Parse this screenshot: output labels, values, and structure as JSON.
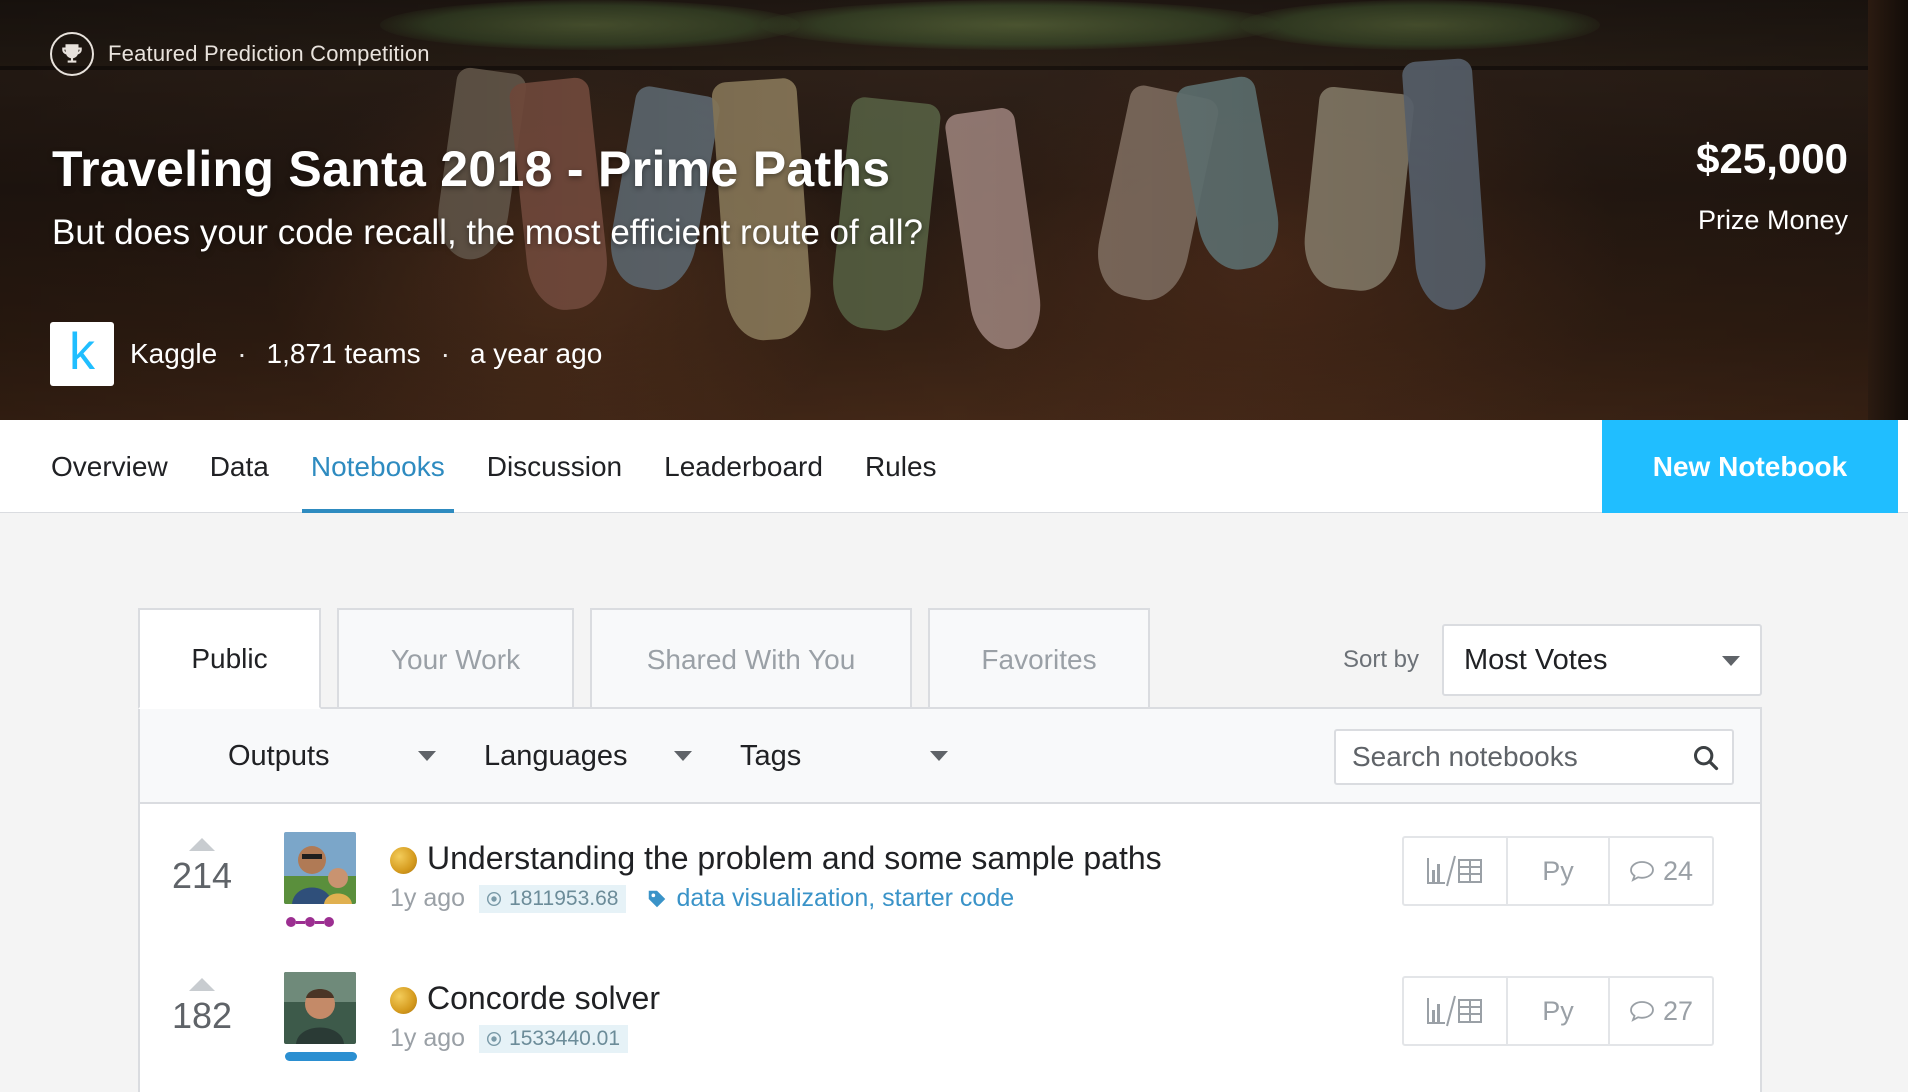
{
  "hero": {
    "badge": "Featured Prediction Competition",
    "title": "Traveling Santa 2018 - Prime Paths",
    "subtitle": "But does your code recall, the most efficient route of all?",
    "prize_amount": "$25,000",
    "prize_label": "Prize Money",
    "host_logo_letter": "k",
    "host": "Kaggle",
    "teams": "1,871 teams",
    "time": "a year ago",
    "separator": "·"
  },
  "nav": {
    "tabs": [
      {
        "label": "Overview",
        "active": false
      },
      {
        "label": "Data",
        "active": false
      },
      {
        "label": "Notebooks",
        "active": true
      },
      {
        "label": "Discussion",
        "active": false
      },
      {
        "label": "Leaderboard",
        "active": false
      },
      {
        "label": "Rules",
        "active": false
      }
    ],
    "new_notebook": "New Notebook"
  },
  "panel": {
    "tabs": [
      {
        "label": "Public",
        "active": true
      },
      {
        "label": "Your Work",
        "active": false
      },
      {
        "label": "Shared With You",
        "active": false
      },
      {
        "label": "Favorites",
        "active": false
      }
    ],
    "sort_label": "Sort by",
    "sort_value": "Most Votes",
    "filters": [
      "Outputs",
      "Languages",
      "Tags"
    ],
    "search_placeholder": "Search notebooks"
  },
  "notebooks": [
    {
      "votes": "214",
      "title": "Understanding the problem and some sample paths",
      "age": "1y ago",
      "score": "1811953.68",
      "tags": "data visualization, starter code",
      "language": "Py",
      "comments": "24",
      "medal": "gold",
      "avatar_icon": "user-avatar-icon"
    },
    {
      "votes": "182",
      "title": "Concorde solver",
      "age": "1y ago",
      "score": "1533440.01",
      "tags": "",
      "language": "Py",
      "comments": "27",
      "medal": "gold",
      "avatar_icon": "user-avatar-icon"
    }
  ],
  "colors": {
    "accent": "#20beff",
    "active_tab": "#2e8bc0",
    "tag_link": "#3a93c8",
    "medal_gold": "#d59b1e"
  }
}
